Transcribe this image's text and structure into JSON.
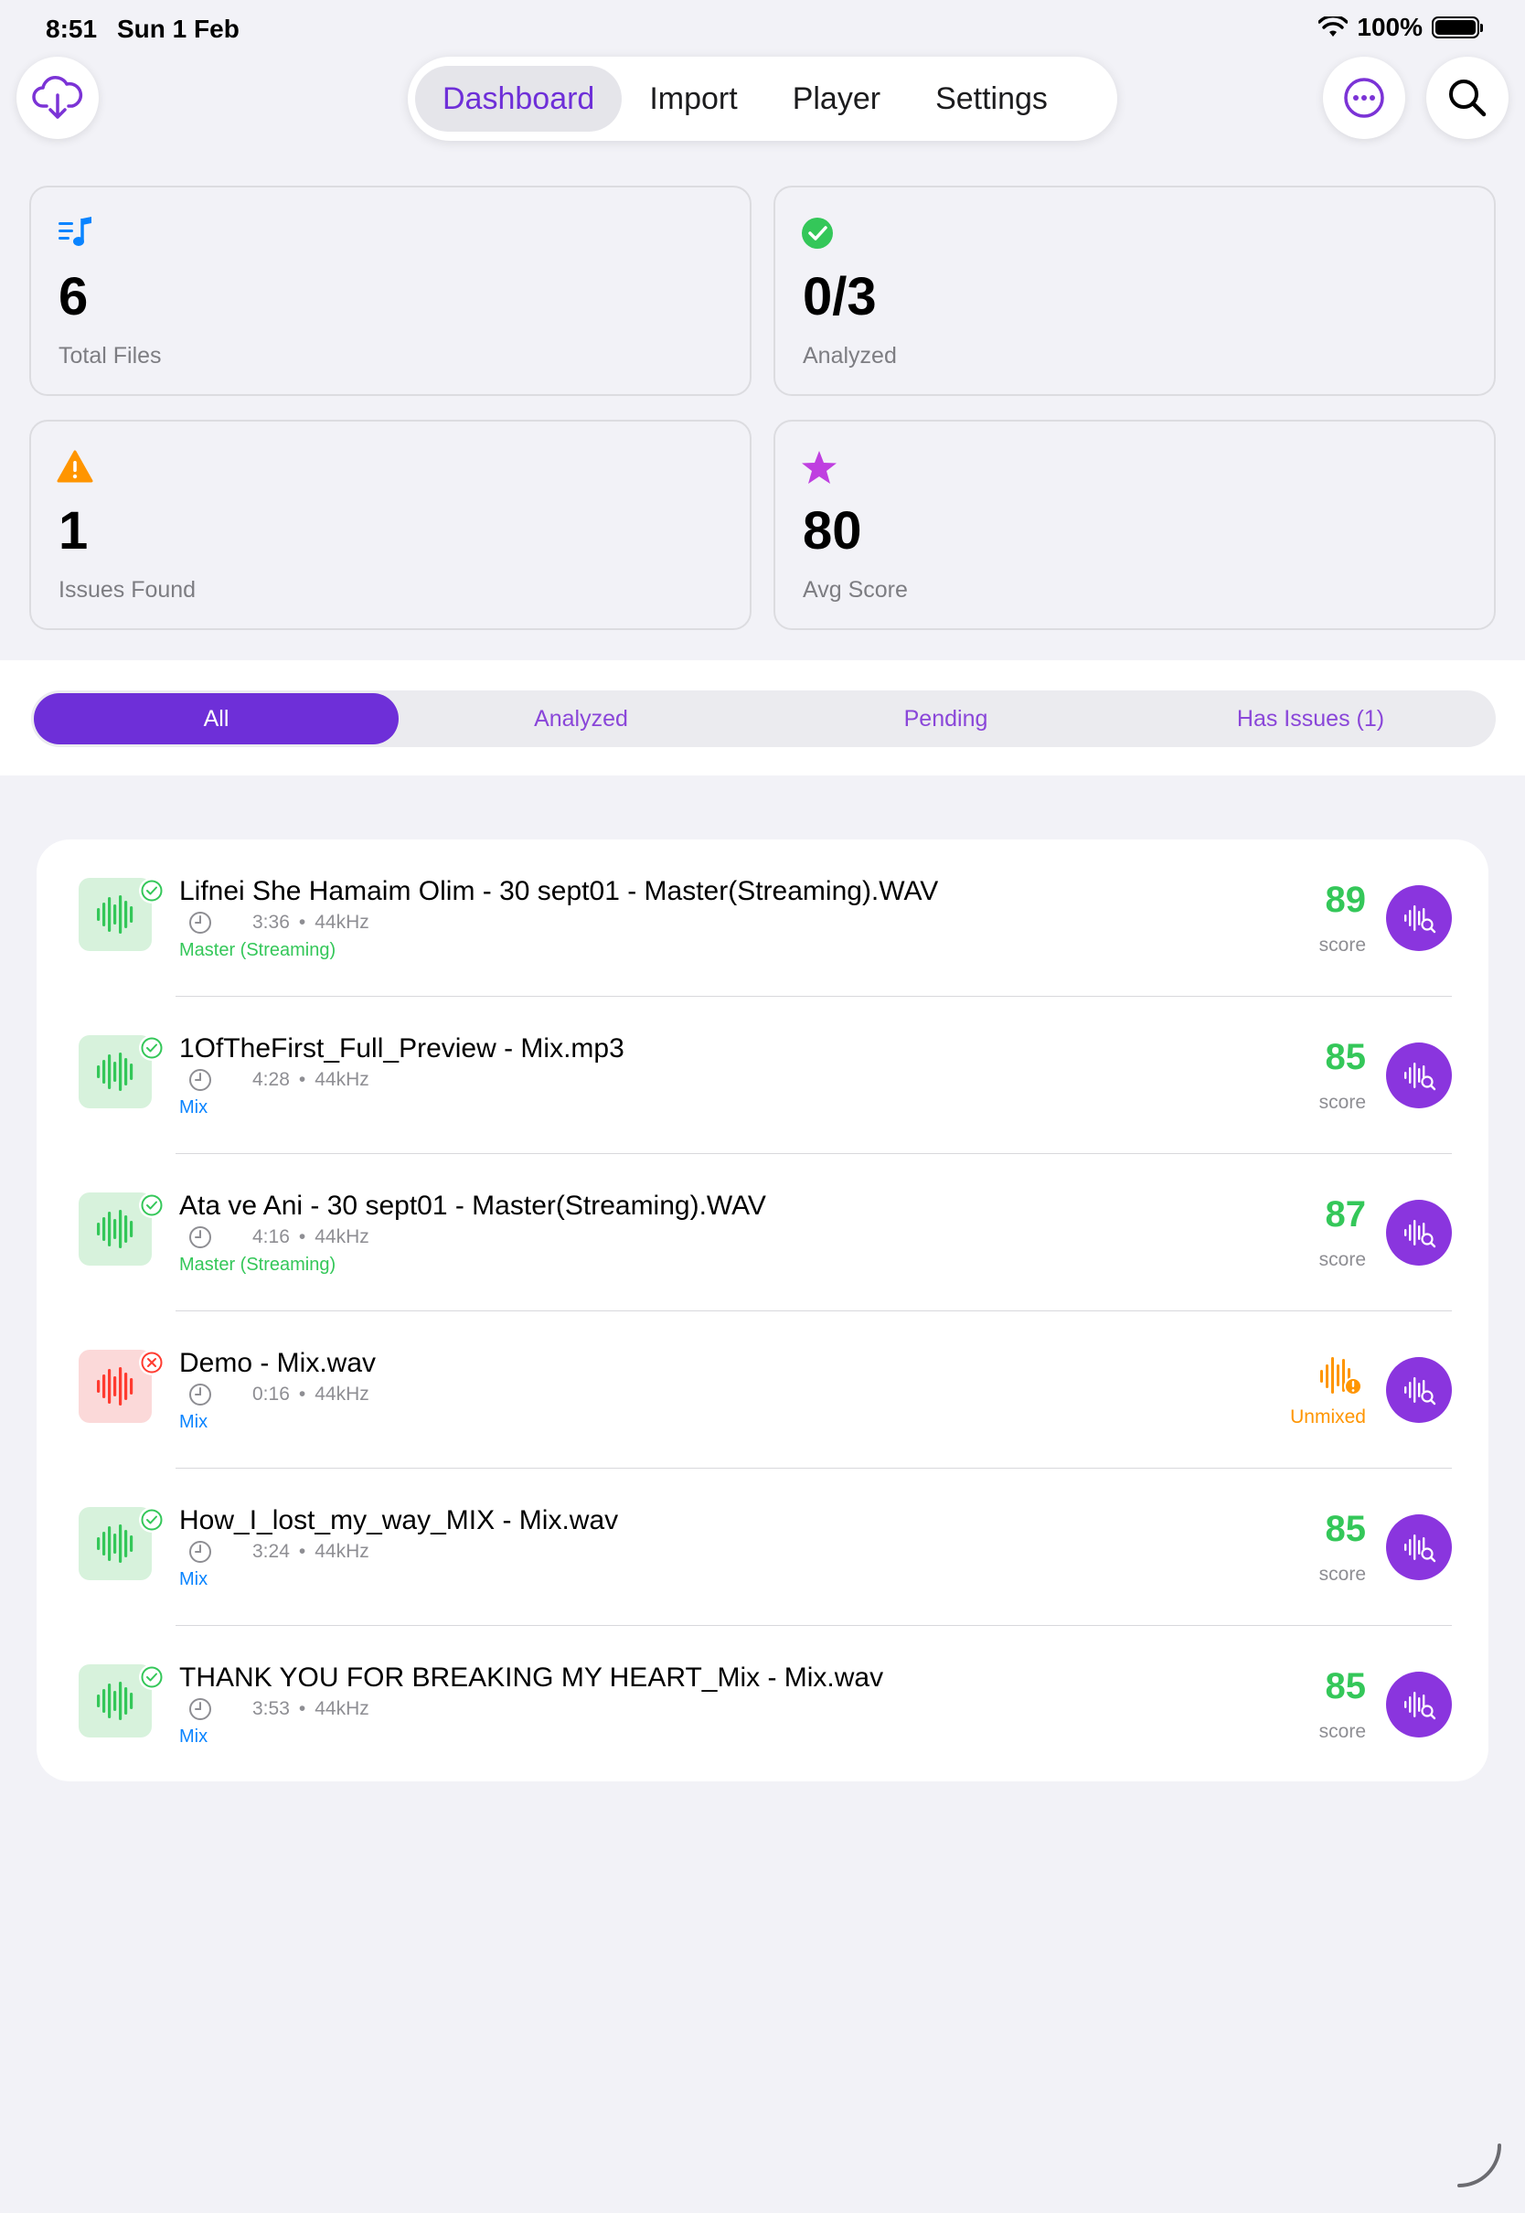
{
  "status_bar": {
    "time": "8:51",
    "date": "Sun 1 Feb",
    "battery": "100%"
  },
  "nav": {
    "tabs": [
      {
        "label": "Dashboard",
        "active": true
      },
      {
        "label": "Import",
        "active": false
      },
      {
        "label": "Player",
        "active": false
      },
      {
        "label": "Settings",
        "active": false
      }
    ]
  },
  "stats": {
    "total_files": {
      "value": "6",
      "label": "Total Files"
    },
    "analyzed": {
      "value": "0/3",
      "label": "Analyzed"
    },
    "issues": {
      "value": "1",
      "label": "Issues Found"
    },
    "avg_score": {
      "value": "80",
      "label": "Avg Score"
    }
  },
  "filters": [
    {
      "label": "All",
      "active": true
    },
    {
      "label": "Analyzed",
      "active": false
    },
    {
      "label": "Pending",
      "active": false
    },
    {
      "label": "Has Issues (1)",
      "active": false
    }
  ],
  "files": [
    {
      "name": "Lifnei She Hamaim Olim - 30 sept01 - Master(Streaming).WAV",
      "duration": "3:36",
      "rate": "44kHz",
      "tag": "Master (Streaming)",
      "score": "89",
      "score_label": "score"
    },
    {
      "name": "1OfTheFirst_Full_Preview - Mix.mp3",
      "duration": "4:28",
      "rate": "44kHz",
      "tag": "Mix",
      "score": "85",
      "score_label": "score"
    },
    {
      "name": "Ata ve Ani - 30 sept01 - Master(Streaming).WAV",
      "duration": "4:16",
      "rate": "44kHz",
      "tag": "Master (Streaming)",
      "score": "87",
      "score_label": "score"
    },
    {
      "name": "Demo - Mix.wav",
      "duration": "0:16",
      "rate": "44kHz",
      "tag": "Mix",
      "status_label": "Unmixed"
    },
    {
      "name": "How_I_lost_my_way_MIX - Mix.wav",
      "duration": "3:24",
      "rate": "44kHz",
      "tag": "Mix",
      "score": "85",
      "score_label": "score"
    },
    {
      "name": "THANK YOU FOR BREAKING MY HEART_Mix - Mix.wav",
      "duration": "3:53",
      "rate": "44kHz",
      "tag": "Mix",
      "score": "85",
      "score_label": "score"
    }
  ],
  "meta_separator": "•",
  "colors": {
    "accent": "#6e2fd8",
    "success": "#34c759",
    "warning": "#ff9500",
    "error": "#ff3b30",
    "link": "#0a84ff"
  }
}
